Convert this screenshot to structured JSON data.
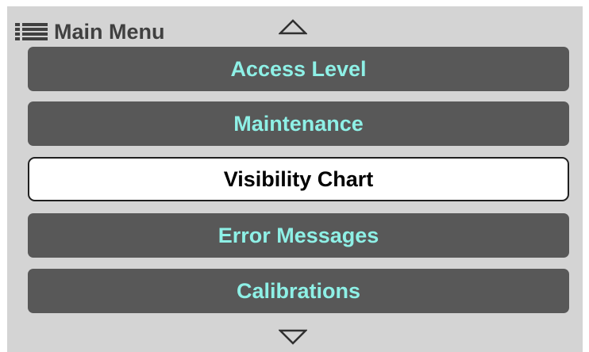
{
  "header": {
    "title": "Main Menu",
    "menu_icon": "hamburger-list-icon",
    "scroll_up_icon": "triangle-up-icon",
    "scroll_down_icon": "triangle-down-icon"
  },
  "menu": {
    "items": [
      {
        "label": "Access Level",
        "selected": false
      },
      {
        "label": "Maintenance",
        "selected": false
      },
      {
        "label": "Visibility Chart",
        "selected": true
      },
      {
        "label": "Error Messages",
        "selected": false
      },
      {
        "label": "Calibrations",
        "selected": false
      }
    ]
  },
  "colors": {
    "screen_background": "#d4d4d4",
    "item_background": "#585858",
    "item_text": "#8ef0e6",
    "selected_background": "#ffffff",
    "selected_text": "#000000",
    "header_text": "#404040"
  }
}
